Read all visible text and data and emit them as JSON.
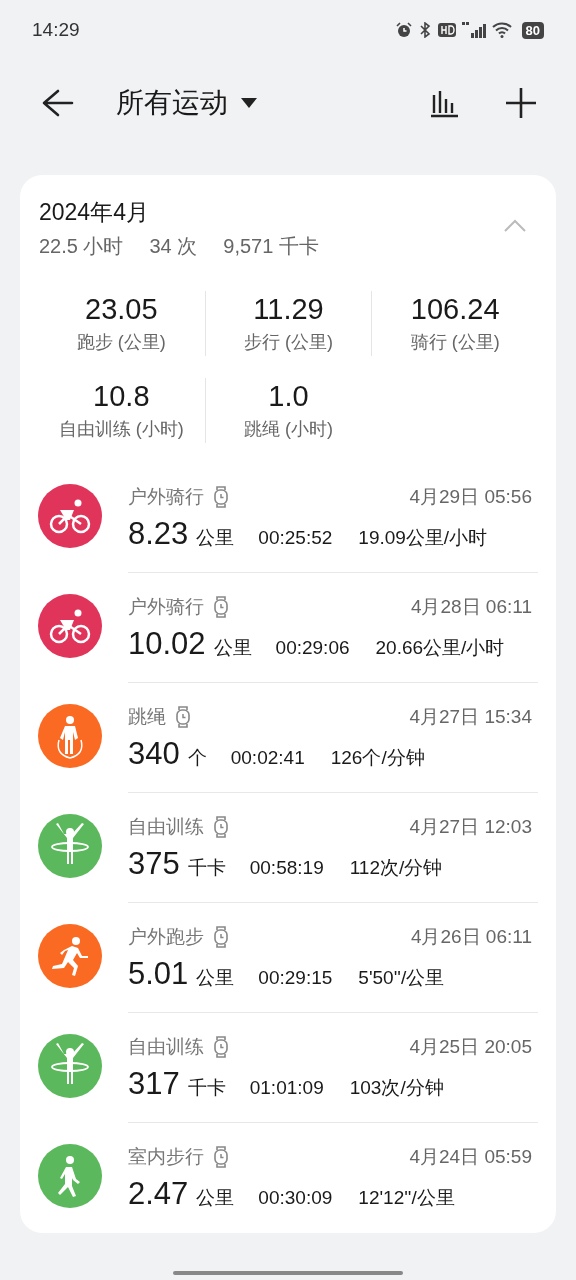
{
  "status_bar": {
    "time": "14:29",
    "battery": "80"
  },
  "header": {
    "title": "所有运动"
  },
  "month": {
    "title": "2024年4月",
    "expanded": true,
    "summary": [
      "22.5 小时",
      "34 次",
      "9,571 千卡"
    ]
  },
  "stats": [
    {
      "value": "23.05",
      "label": "跑步 (公里)"
    },
    {
      "value": "11.29",
      "label": "步行 (公里)"
    },
    {
      "value": "106.24",
      "label": "骑行 (公里)"
    },
    {
      "value": "10.8",
      "label": "自由训练 (小时)"
    },
    {
      "value": "1.0",
      "label": "跳绳 (小时)"
    }
  ],
  "records": [
    {
      "kind": "cycling",
      "color": "#e0345a",
      "name": "户外骑行",
      "date": "4月29日 05:56",
      "value": "8.23",
      "unit": "公里",
      "duration": "00:25:52",
      "rate": "19.09公里/小时"
    },
    {
      "kind": "cycling",
      "color": "#e0345a",
      "name": "户外骑行",
      "date": "4月28日 06:11",
      "value": "10.02",
      "unit": "公里",
      "duration": "00:29:06",
      "rate": "20.66公里/小时"
    },
    {
      "kind": "rope",
      "color": "#fa6a22",
      "name": "跳绳",
      "date": "4月27日 15:34",
      "value": "340",
      "unit": "个",
      "duration": "00:02:41",
      "rate": "126个/分钟"
    },
    {
      "kind": "training",
      "color": "#5cb85c",
      "name": "自由训练",
      "date": "4月27日 12:03",
      "value": "375",
      "unit": "千卡",
      "duration": "00:58:19",
      "rate": "112次/分钟"
    },
    {
      "kind": "running",
      "color": "#fa6a22",
      "name": "户外跑步",
      "date": "4月26日 06:11",
      "value": "5.01",
      "unit": "公里",
      "duration": "00:29:15",
      "rate": "5'50''/公里"
    },
    {
      "kind": "training",
      "color": "#5cb85c",
      "name": "自由训练",
      "date": "4月25日 20:05",
      "value": "317",
      "unit": "千卡",
      "duration": "01:01:09",
      "rate": "103次/分钟"
    },
    {
      "kind": "walking",
      "color": "#5cb85c",
      "name": "室内步行",
      "date": "4月24日 05:59",
      "value": "2.47",
      "unit": "公里",
      "duration": "00:30:09",
      "rate": "12'12''/公里"
    }
  ]
}
